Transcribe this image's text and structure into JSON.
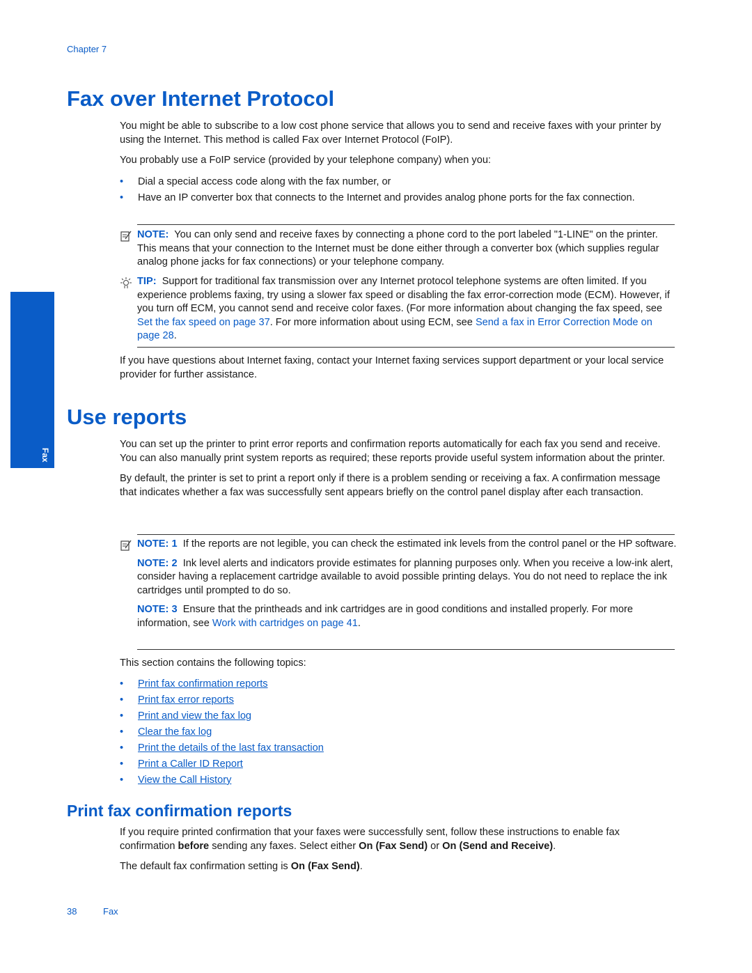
{
  "header": {
    "chapter": "Chapter 7"
  },
  "side_tab": {
    "label": "Fax"
  },
  "section1": {
    "title": "Fax over Internet Protocol",
    "p1": "You might be able to subscribe to a low cost phone service that allows you to send and receive faxes with your printer by using the Internet. This method is called Fax over Internet Protocol (FoIP).",
    "p2": "You probably use a FoIP service (provided by your telephone company) when you:",
    "bullets": [
      "Dial a special access code along with the fax number, or",
      "Have an IP converter box that connects to the Internet and provides analog phone ports for the fax connection."
    ],
    "note": {
      "label": "NOTE:",
      "text": "You can only send and receive faxes by connecting a phone cord to the port labeled \"1-LINE\" on the printer. This means that your connection to the Internet must be done either through a converter box (which supplies regular analog phone jacks for fax connections) or your telephone company."
    },
    "tip": {
      "label": "TIP:",
      "text_before": "Support for traditional fax transmission over any Internet protocol telephone systems are often limited. If you experience problems faxing, try using a slower fax speed or disabling the fax error-correction mode (ECM). However, if you turn off ECM, you cannot send and receive color faxes. (For more information about changing the fax speed, see ",
      "link1": "Set the fax speed on page 37",
      "text_middle": ". For more information about using ECM, see ",
      "link2": "Send a fax in Error Correction Mode on page 28",
      "text_after": "."
    },
    "p3": "If you have questions about Internet faxing, contact your Internet faxing services support department or your local service provider for further assistance."
  },
  "section2": {
    "title": "Use reports",
    "p1": "You can set up the printer to print error reports and confirmation reports automatically for each fax you send and receive. You can also manually print system reports as required; these reports provide useful system information about the printer.",
    "p2": "By default, the printer is set to print a report only if there is a problem sending or receiving a fax. A confirmation message that indicates whether a fax was successfully sent appears briefly on the control panel display after each transaction.",
    "notes": [
      {
        "label": "NOTE: 1",
        "text": "If the reports are not legible, you can check the estimated ink levels from the control panel or the HP software."
      },
      {
        "label": "NOTE: 2",
        "text": "Ink level alerts and indicators provide estimates for planning purposes only. When you receive a low-ink alert, consider having a replacement cartridge available to avoid possible printing delays. You do not need to replace the ink cartridges until prompted to do so."
      },
      {
        "label": "NOTE: 3",
        "text_before": "Ensure that the printheads and ink cartridges are in good conditions and installed properly. For more information, see ",
        "link": "Work with cartridges on page 41",
        "text_after": "."
      }
    ],
    "topics_intro": "This section contains the following topics:",
    "topics": [
      "Print fax confirmation reports",
      "Print fax error reports",
      "Print and view the fax log",
      "Clear the fax log",
      "Print the details of the last fax transaction",
      "Print a Caller ID Report",
      "View the Call History"
    ]
  },
  "section3": {
    "title": "Print fax confirmation reports",
    "p1_a": "If you require printed confirmation that your faxes were successfully sent, follow these instructions to enable fax confirmation ",
    "p1_b": "before",
    "p1_c": " sending any faxes. Select either ",
    "p1_d": "On (Fax Send)",
    "p1_e": " or ",
    "p1_f": "On (Send and Receive)",
    "p1_g": ".",
    "p2_a": "The default fax confirmation setting is ",
    "p2_b": "On (Fax Send)",
    "p2_c": "."
  },
  "footer": {
    "page_number": "38",
    "section": "Fax"
  },
  "bullet_glyph": "•"
}
